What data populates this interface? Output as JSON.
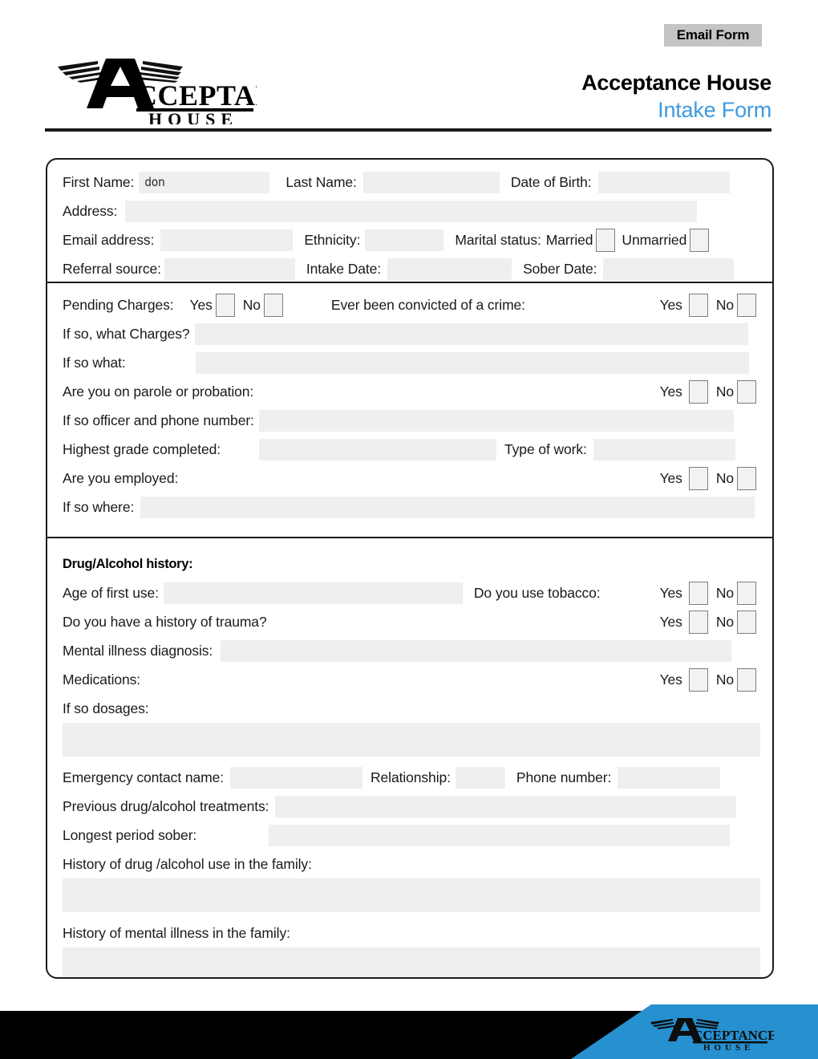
{
  "header": {
    "email_form_label": "Email Form",
    "org_name": "Acceptance House",
    "form_title": "Intake Form",
    "logo_primary": "ACCEPTANCE",
    "logo_secondary": "H O U S E",
    "accent_blue": "#3d9ae0",
    "footer_blue": "#2690d0",
    "button_gray": "#c4c4c4"
  },
  "personal": {
    "first_name_label": "First Name:",
    "first_name_value": "don",
    "last_name_label": "Last Name:",
    "last_name_value": "",
    "dob_label": "Date of Birth:",
    "dob_value": "",
    "address_label": "Address:",
    "address_value": "",
    "email_label": "Email address:",
    "email_value": "",
    "ethnicity_label": "Ethnicity:",
    "ethnicity_value": "",
    "marital_label": "Marital status:",
    "married_label": "Married",
    "unmarried_label": "Unmarried",
    "referral_label": "Referral source:",
    "referral_value": "",
    "intake_date_label": "Intake Date:",
    "intake_date_value": "",
    "sober_date_label": "Sober Date:",
    "sober_date_value": ""
  },
  "legal": {
    "pending_charges_label": "Pending Charges:",
    "convicted_label": "Ever been convicted of a crime:",
    "what_charges_label": "If so, what Charges?",
    "what_charges_value": "",
    "if_so_what_label": "If so what:",
    "if_so_what_value": "",
    "parole_label": "Are you on parole or probation:",
    "officer_label": "If so officer and phone number:",
    "officer_value": "",
    "grade_label": "Highest grade completed:",
    "grade_value": "",
    "work_type_label": "Type of work:",
    "work_type_value": "",
    "employed_label": "Are you employed:",
    "if_so_where_label": "If so where:",
    "if_so_where_value": "",
    "yes_label": "Yes",
    "no_label": "No"
  },
  "drug": {
    "section_title": "Drug/Alcohol history:",
    "age_first_use_label": "Age of first use:",
    "age_first_use_value": "",
    "tobacco_label": "Do you use tobacco:",
    "trauma_label": "Do you have a history of trauma?",
    "mental_illness_label": "Mental illness diagnosis:",
    "mental_illness_value": "",
    "medications_label": "Medications:",
    "dosages_label": "If so dosages:",
    "dosages_value": "",
    "emergency_contact_label": "Emergency contact name:",
    "emergency_contact_value": "",
    "relationship_label": "Relationship:",
    "relationship_value": "",
    "phone_label": "Phone number:",
    "phone_value": "",
    "previous_treatments_label": "Previous drug/alcohol treatments:",
    "previous_treatments_value": "",
    "longest_sober_label": "Longest period sober:",
    "longest_sober_value": "",
    "family_drug_label": "History of drug /alcohol use in the family:",
    "family_drug_value": "",
    "family_mental_label": "History of mental illness in the family:",
    "family_mental_value": "",
    "yes_label": "Yes",
    "no_label": "No"
  }
}
